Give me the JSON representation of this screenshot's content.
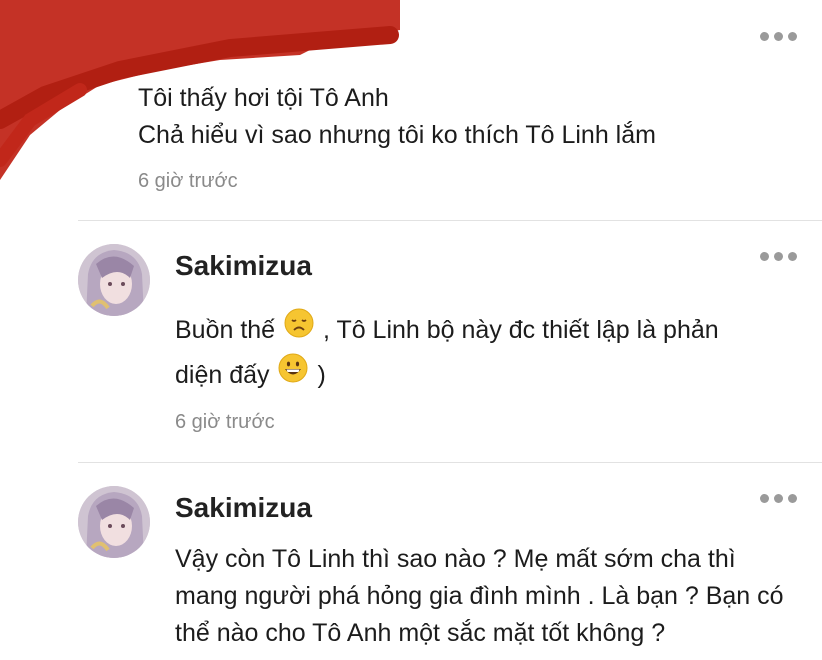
{
  "comments": [
    {
      "username": "",
      "lines": [
        "Tôi thấy hơi tội Tô Anh",
        "Chả hiểu vì sao nhưng tôi ko thích Tô Linh lắm"
      ],
      "time": "6 giờ trước"
    },
    {
      "username": "Sakimizua",
      "line1_a": "Buồn thế",
      "line1_b": ", Tô Linh bộ này đc thiết lập là phản",
      "line2_a": "diện đấy",
      "line2_b": ")",
      "emoji1": "disappointed-face",
      "emoji2": "grinning-face",
      "time": "6 giờ trước"
    },
    {
      "username": "Sakimizua",
      "lines": [
        "Vậy còn Tô Linh thì sao nào ? Mẹ mất sớm cha thì",
        "mang người phá hỏng gia đình mình . Là bạn ? Bạn có",
        "thể nào cho Tô Anh một sắc mặt tốt không ?"
      ]
    }
  ],
  "colors": {
    "redaction": "#c1271a",
    "divider": "#e2e2e2",
    "muted": "#8a8a8a"
  }
}
